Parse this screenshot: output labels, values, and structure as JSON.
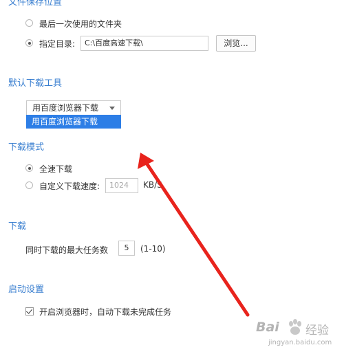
{
  "save_location": {
    "title": "文件保存位置",
    "option_last_used": "最后一次使用的文件夹",
    "option_specified": "指定目录:",
    "path_value": "C:\\百度高速下载\\",
    "browse_label": "浏览..."
  },
  "default_tool": {
    "title": "默认下载工具",
    "selected": "用百度浏览器下载",
    "options": [
      "用百度浏览器下载"
    ]
  },
  "download_mode": {
    "title": "下载模式",
    "option_full_speed": "全速下载",
    "option_custom": "自定义下载速度:",
    "speed_value": "1024",
    "speed_unit": "KB/S"
  },
  "download": {
    "title": "下载",
    "max_tasks_label": "同时下载的最大任务数",
    "max_tasks_value": "5",
    "range_hint": "(1-10)"
  },
  "startup": {
    "title": "启动设置",
    "resume_on_start_label": "开启浏览器时，自动下载未完成任务"
  },
  "watermark": {
    "brand": "Bai",
    "brand_suffix": "经验",
    "url": "jingyan.baidu.com"
  },
  "colors": {
    "section_title": "#3a7fd0",
    "highlight": "#2d7ee6",
    "arrow": "#e8231c"
  }
}
